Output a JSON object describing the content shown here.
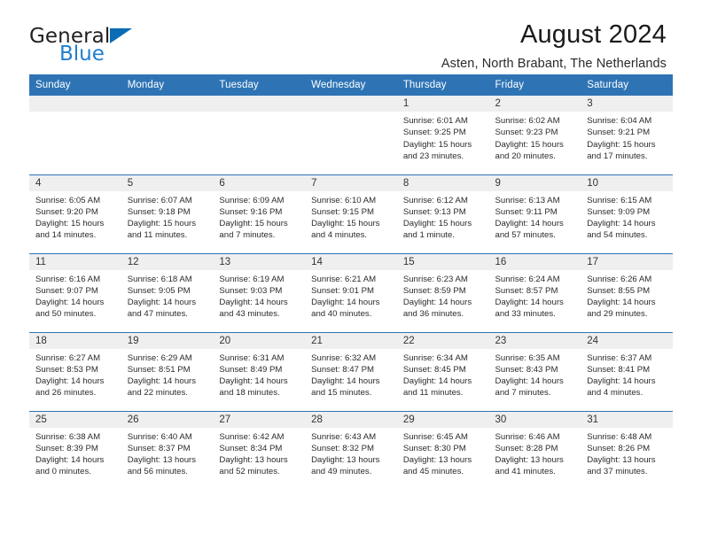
{
  "logo": {
    "word1": "General",
    "word2": "Blue",
    "triangle_icon": "triangle-icon",
    "color_dark": "#231f20",
    "color_blue": "#1f7fd0"
  },
  "header": {
    "month_title": "August 2024",
    "location": "Asten, North Brabant, The Netherlands",
    "accent_color": "#2e74b5",
    "daynum_band_color": "#efefef"
  },
  "calendar": {
    "weekday_headers": [
      "Sunday",
      "Monday",
      "Tuesday",
      "Wednesday",
      "Thursday",
      "Friday",
      "Saturday"
    ],
    "weeks": [
      [
        {
          "day": "",
          "lines": []
        },
        {
          "day": "",
          "lines": []
        },
        {
          "day": "",
          "lines": []
        },
        {
          "day": "",
          "lines": []
        },
        {
          "day": "1",
          "lines": [
            "Sunrise: 6:01 AM",
            "Sunset: 9:25 PM",
            "Daylight: 15 hours",
            "and 23 minutes."
          ]
        },
        {
          "day": "2",
          "lines": [
            "Sunrise: 6:02 AM",
            "Sunset: 9:23 PM",
            "Daylight: 15 hours",
            "and 20 minutes."
          ]
        },
        {
          "day": "3",
          "lines": [
            "Sunrise: 6:04 AM",
            "Sunset: 9:21 PM",
            "Daylight: 15 hours",
            "and 17 minutes."
          ]
        }
      ],
      [
        {
          "day": "4",
          "lines": [
            "Sunrise: 6:05 AM",
            "Sunset: 9:20 PM",
            "Daylight: 15 hours",
            "and 14 minutes."
          ]
        },
        {
          "day": "5",
          "lines": [
            "Sunrise: 6:07 AM",
            "Sunset: 9:18 PM",
            "Daylight: 15 hours",
            "and 11 minutes."
          ]
        },
        {
          "day": "6",
          "lines": [
            "Sunrise: 6:09 AM",
            "Sunset: 9:16 PM",
            "Daylight: 15 hours",
            "and 7 minutes."
          ]
        },
        {
          "day": "7",
          "lines": [
            "Sunrise: 6:10 AM",
            "Sunset: 9:15 PM",
            "Daylight: 15 hours",
            "and 4 minutes."
          ]
        },
        {
          "day": "8",
          "lines": [
            "Sunrise: 6:12 AM",
            "Sunset: 9:13 PM",
            "Daylight: 15 hours",
            "and 1 minute."
          ]
        },
        {
          "day": "9",
          "lines": [
            "Sunrise: 6:13 AM",
            "Sunset: 9:11 PM",
            "Daylight: 14 hours",
            "and 57 minutes."
          ]
        },
        {
          "day": "10",
          "lines": [
            "Sunrise: 6:15 AM",
            "Sunset: 9:09 PM",
            "Daylight: 14 hours",
            "and 54 minutes."
          ]
        }
      ],
      [
        {
          "day": "11",
          "lines": [
            "Sunrise: 6:16 AM",
            "Sunset: 9:07 PM",
            "Daylight: 14 hours",
            "and 50 minutes."
          ]
        },
        {
          "day": "12",
          "lines": [
            "Sunrise: 6:18 AM",
            "Sunset: 9:05 PM",
            "Daylight: 14 hours",
            "and 47 minutes."
          ]
        },
        {
          "day": "13",
          "lines": [
            "Sunrise: 6:19 AM",
            "Sunset: 9:03 PM",
            "Daylight: 14 hours",
            "and 43 minutes."
          ]
        },
        {
          "day": "14",
          "lines": [
            "Sunrise: 6:21 AM",
            "Sunset: 9:01 PM",
            "Daylight: 14 hours",
            "and 40 minutes."
          ]
        },
        {
          "day": "15",
          "lines": [
            "Sunrise: 6:23 AM",
            "Sunset: 8:59 PM",
            "Daylight: 14 hours",
            "and 36 minutes."
          ]
        },
        {
          "day": "16",
          "lines": [
            "Sunrise: 6:24 AM",
            "Sunset: 8:57 PM",
            "Daylight: 14 hours",
            "and 33 minutes."
          ]
        },
        {
          "day": "17",
          "lines": [
            "Sunrise: 6:26 AM",
            "Sunset: 8:55 PM",
            "Daylight: 14 hours",
            "and 29 minutes."
          ]
        }
      ],
      [
        {
          "day": "18",
          "lines": [
            "Sunrise: 6:27 AM",
            "Sunset: 8:53 PM",
            "Daylight: 14 hours",
            "and 26 minutes."
          ]
        },
        {
          "day": "19",
          "lines": [
            "Sunrise: 6:29 AM",
            "Sunset: 8:51 PM",
            "Daylight: 14 hours",
            "and 22 minutes."
          ]
        },
        {
          "day": "20",
          "lines": [
            "Sunrise: 6:31 AM",
            "Sunset: 8:49 PM",
            "Daylight: 14 hours",
            "and 18 minutes."
          ]
        },
        {
          "day": "21",
          "lines": [
            "Sunrise: 6:32 AM",
            "Sunset: 8:47 PM",
            "Daylight: 14 hours",
            "and 15 minutes."
          ]
        },
        {
          "day": "22",
          "lines": [
            "Sunrise: 6:34 AM",
            "Sunset: 8:45 PM",
            "Daylight: 14 hours",
            "and 11 minutes."
          ]
        },
        {
          "day": "23",
          "lines": [
            "Sunrise: 6:35 AM",
            "Sunset: 8:43 PM",
            "Daylight: 14 hours",
            "and 7 minutes."
          ]
        },
        {
          "day": "24",
          "lines": [
            "Sunrise: 6:37 AM",
            "Sunset: 8:41 PM",
            "Daylight: 14 hours",
            "and 4 minutes."
          ]
        }
      ],
      [
        {
          "day": "25",
          "lines": [
            "Sunrise: 6:38 AM",
            "Sunset: 8:39 PM",
            "Daylight: 14 hours",
            "and 0 minutes."
          ]
        },
        {
          "day": "26",
          "lines": [
            "Sunrise: 6:40 AM",
            "Sunset: 8:37 PM",
            "Daylight: 13 hours",
            "and 56 minutes."
          ]
        },
        {
          "day": "27",
          "lines": [
            "Sunrise: 6:42 AM",
            "Sunset: 8:34 PM",
            "Daylight: 13 hours",
            "and 52 minutes."
          ]
        },
        {
          "day": "28",
          "lines": [
            "Sunrise: 6:43 AM",
            "Sunset: 8:32 PM",
            "Daylight: 13 hours",
            "and 49 minutes."
          ]
        },
        {
          "day": "29",
          "lines": [
            "Sunrise: 6:45 AM",
            "Sunset: 8:30 PM",
            "Daylight: 13 hours",
            "and 45 minutes."
          ]
        },
        {
          "day": "30",
          "lines": [
            "Sunrise: 6:46 AM",
            "Sunset: 8:28 PM",
            "Daylight: 13 hours",
            "and 41 minutes."
          ]
        },
        {
          "day": "31",
          "lines": [
            "Sunrise: 6:48 AM",
            "Sunset: 8:26 PM",
            "Daylight: 13 hours",
            "and 37 minutes."
          ]
        }
      ]
    ]
  }
}
